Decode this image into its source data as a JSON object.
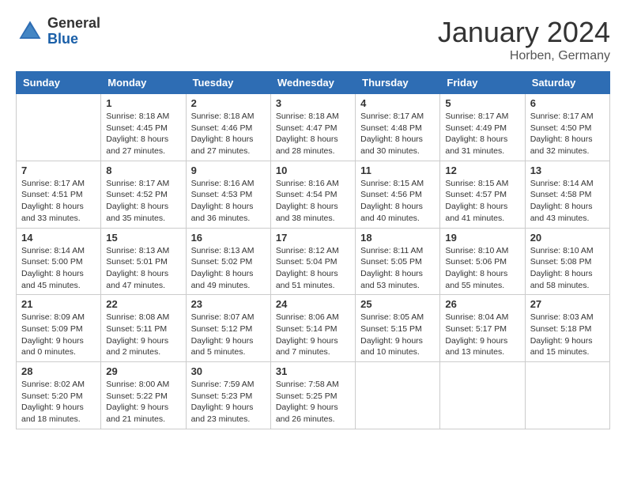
{
  "header": {
    "logo_general": "General",
    "logo_blue": "Blue",
    "month_title": "January 2024",
    "location": "Horben, Germany"
  },
  "weekdays": [
    "Sunday",
    "Monday",
    "Tuesday",
    "Wednesday",
    "Thursday",
    "Friday",
    "Saturday"
  ],
  "weeks": [
    [
      {
        "day": "",
        "info": ""
      },
      {
        "day": "1",
        "info": "Sunrise: 8:18 AM\nSunset: 4:45 PM\nDaylight: 8 hours\nand 27 minutes."
      },
      {
        "day": "2",
        "info": "Sunrise: 8:18 AM\nSunset: 4:46 PM\nDaylight: 8 hours\nand 27 minutes."
      },
      {
        "day": "3",
        "info": "Sunrise: 8:18 AM\nSunset: 4:47 PM\nDaylight: 8 hours\nand 28 minutes."
      },
      {
        "day": "4",
        "info": "Sunrise: 8:17 AM\nSunset: 4:48 PM\nDaylight: 8 hours\nand 30 minutes."
      },
      {
        "day": "5",
        "info": "Sunrise: 8:17 AM\nSunset: 4:49 PM\nDaylight: 8 hours\nand 31 minutes."
      },
      {
        "day": "6",
        "info": "Sunrise: 8:17 AM\nSunset: 4:50 PM\nDaylight: 8 hours\nand 32 minutes."
      }
    ],
    [
      {
        "day": "7",
        "info": "Sunrise: 8:17 AM\nSunset: 4:51 PM\nDaylight: 8 hours\nand 33 minutes."
      },
      {
        "day": "8",
        "info": "Sunrise: 8:17 AM\nSunset: 4:52 PM\nDaylight: 8 hours\nand 35 minutes."
      },
      {
        "day": "9",
        "info": "Sunrise: 8:16 AM\nSunset: 4:53 PM\nDaylight: 8 hours\nand 36 minutes."
      },
      {
        "day": "10",
        "info": "Sunrise: 8:16 AM\nSunset: 4:54 PM\nDaylight: 8 hours\nand 38 minutes."
      },
      {
        "day": "11",
        "info": "Sunrise: 8:15 AM\nSunset: 4:56 PM\nDaylight: 8 hours\nand 40 minutes."
      },
      {
        "day": "12",
        "info": "Sunrise: 8:15 AM\nSunset: 4:57 PM\nDaylight: 8 hours\nand 41 minutes."
      },
      {
        "day": "13",
        "info": "Sunrise: 8:14 AM\nSunset: 4:58 PM\nDaylight: 8 hours\nand 43 minutes."
      }
    ],
    [
      {
        "day": "14",
        "info": "Sunrise: 8:14 AM\nSunset: 5:00 PM\nDaylight: 8 hours\nand 45 minutes."
      },
      {
        "day": "15",
        "info": "Sunrise: 8:13 AM\nSunset: 5:01 PM\nDaylight: 8 hours\nand 47 minutes."
      },
      {
        "day": "16",
        "info": "Sunrise: 8:13 AM\nSunset: 5:02 PM\nDaylight: 8 hours\nand 49 minutes."
      },
      {
        "day": "17",
        "info": "Sunrise: 8:12 AM\nSunset: 5:04 PM\nDaylight: 8 hours\nand 51 minutes."
      },
      {
        "day": "18",
        "info": "Sunrise: 8:11 AM\nSunset: 5:05 PM\nDaylight: 8 hours\nand 53 minutes."
      },
      {
        "day": "19",
        "info": "Sunrise: 8:10 AM\nSunset: 5:06 PM\nDaylight: 8 hours\nand 55 minutes."
      },
      {
        "day": "20",
        "info": "Sunrise: 8:10 AM\nSunset: 5:08 PM\nDaylight: 8 hours\nand 58 minutes."
      }
    ],
    [
      {
        "day": "21",
        "info": "Sunrise: 8:09 AM\nSunset: 5:09 PM\nDaylight: 9 hours\nand 0 minutes."
      },
      {
        "day": "22",
        "info": "Sunrise: 8:08 AM\nSunset: 5:11 PM\nDaylight: 9 hours\nand 2 minutes."
      },
      {
        "day": "23",
        "info": "Sunrise: 8:07 AM\nSunset: 5:12 PM\nDaylight: 9 hours\nand 5 minutes."
      },
      {
        "day": "24",
        "info": "Sunrise: 8:06 AM\nSunset: 5:14 PM\nDaylight: 9 hours\nand 7 minutes."
      },
      {
        "day": "25",
        "info": "Sunrise: 8:05 AM\nSunset: 5:15 PM\nDaylight: 9 hours\nand 10 minutes."
      },
      {
        "day": "26",
        "info": "Sunrise: 8:04 AM\nSunset: 5:17 PM\nDaylight: 9 hours\nand 13 minutes."
      },
      {
        "day": "27",
        "info": "Sunrise: 8:03 AM\nSunset: 5:18 PM\nDaylight: 9 hours\nand 15 minutes."
      }
    ],
    [
      {
        "day": "28",
        "info": "Sunrise: 8:02 AM\nSunset: 5:20 PM\nDaylight: 9 hours\nand 18 minutes."
      },
      {
        "day": "29",
        "info": "Sunrise: 8:00 AM\nSunset: 5:22 PM\nDaylight: 9 hours\nand 21 minutes."
      },
      {
        "day": "30",
        "info": "Sunrise: 7:59 AM\nSunset: 5:23 PM\nDaylight: 9 hours\nand 23 minutes."
      },
      {
        "day": "31",
        "info": "Sunrise: 7:58 AM\nSunset: 5:25 PM\nDaylight: 9 hours\nand 26 minutes."
      },
      {
        "day": "",
        "info": ""
      },
      {
        "day": "",
        "info": ""
      },
      {
        "day": "",
        "info": ""
      }
    ]
  ]
}
